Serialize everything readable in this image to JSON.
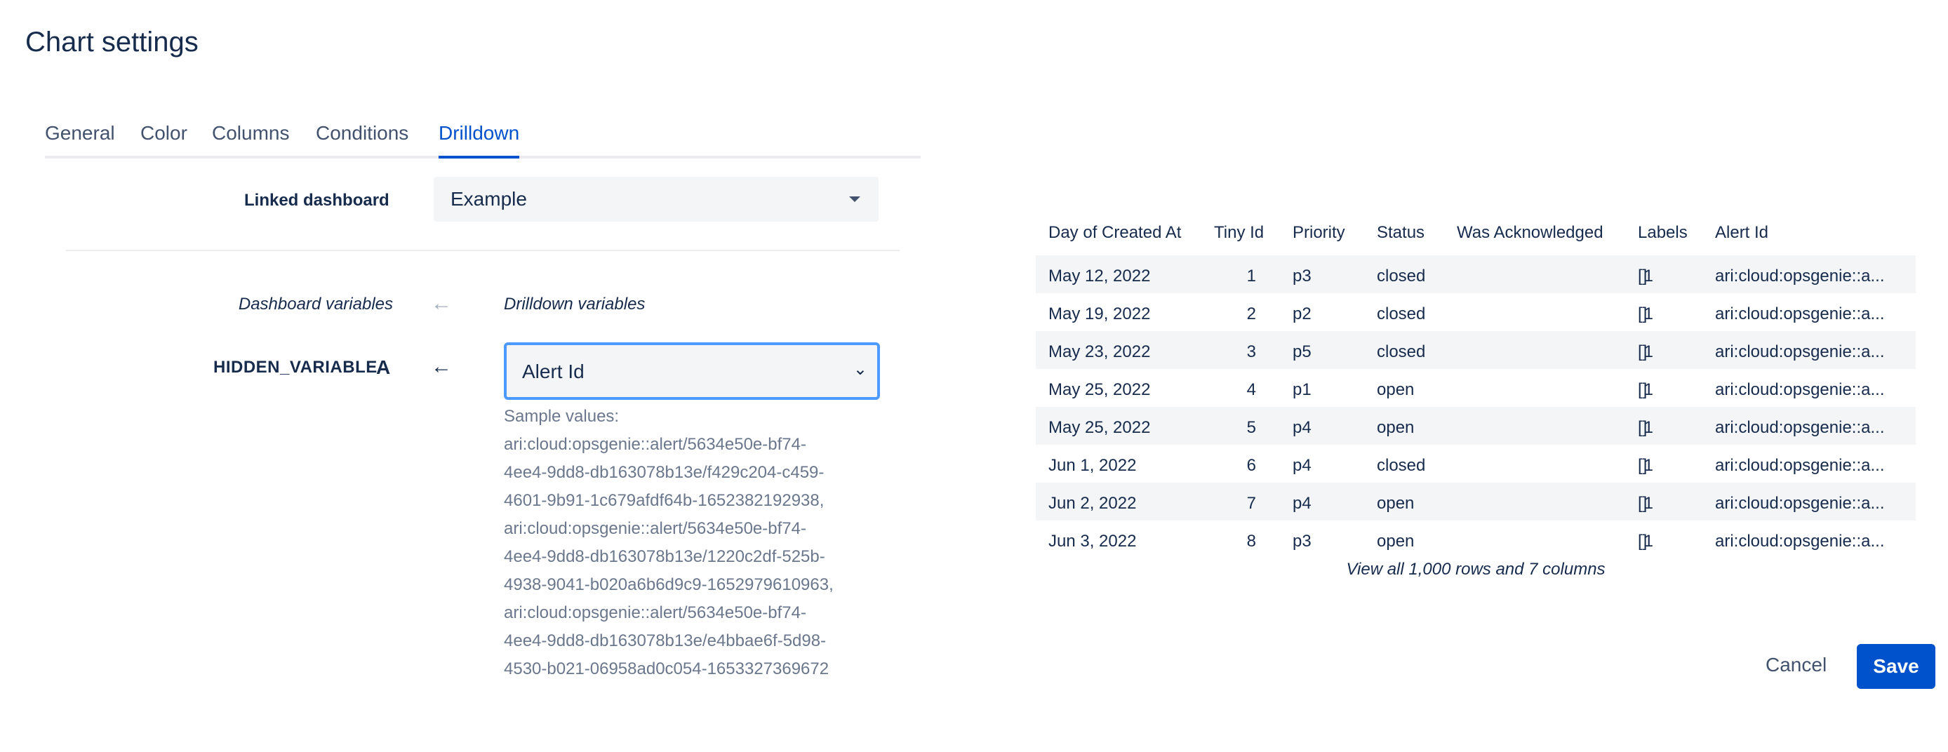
{
  "title": "Chart settings",
  "tabs": [
    {
      "label": "General"
    },
    {
      "label": "Color"
    },
    {
      "label": "Columns"
    },
    {
      "label": "Conditions"
    },
    {
      "label": "Drilldown",
      "active": true
    }
  ],
  "linked_dashboard": {
    "label": "Linked dashboard",
    "value": "Example"
  },
  "variables": {
    "dashboard_label": "Dashboard variables",
    "drilldown_label": "Drilldown variables",
    "name": "HIDDEN_VARIABLE",
    "name_icon": "A",
    "selected": "Alert Id",
    "sample_title": "Sample values:",
    "sample_lines": [
      "ari:cloud:opsgenie::alert/5634e50e-bf74-",
      "4ee4-9dd8-db163078b13e/f429c204-c459-",
      "4601-9b91-1c679afdf64b-1652382192938,",
      "ari:cloud:opsgenie::alert/5634e50e-bf74-",
      "4ee4-9dd8-db163078b13e/1220c2df-525b-",
      "4938-9041-b020a6b6d9c9-1652979610963,",
      "ari:cloud:opsgenie::alert/5634e50e-bf74-",
      "4ee4-9dd8-db163078b13e/e4bbae6f-5d98-",
      "4530-b021-06958ad0c054-1653327369672"
    ]
  },
  "table": {
    "headers": [
      "Day of Created At",
      "Tiny Id",
      "Priority",
      "Status",
      "Was Acknowledged",
      "Labels",
      "Alert Id"
    ],
    "rows": [
      [
        "May 12, 2022",
        "1",
        "p3",
        "closed",
        "1",
        "[]",
        "ari:cloud:opsgenie::a..."
      ],
      [
        "May 19, 2022",
        "2",
        "p2",
        "closed",
        "1",
        "[]",
        "ari:cloud:opsgenie::a..."
      ],
      [
        "May 23, 2022",
        "3",
        "p5",
        "closed",
        "1",
        "[]",
        "ari:cloud:opsgenie::a..."
      ],
      [
        "May 25, 2022",
        "4",
        "p1",
        "open",
        "1",
        "[]",
        "ari:cloud:opsgenie::a..."
      ],
      [
        "May 25, 2022",
        "5",
        "p4",
        "open",
        "1",
        "[]",
        "ari:cloud:opsgenie::a..."
      ],
      [
        "Jun 1, 2022",
        "6",
        "p4",
        "closed",
        "1",
        "[]",
        "ari:cloud:opsgenie::a..."
      ],
      [
        "Jun 2, 2022",
        "7",
        "p4",
        "open",
        "1",
        "[]",
        "ari:cloud:opsgenie::a..."
      ],
      [
        "Jun 3, 2022",
        "8",
        "p3",
        "open",
        "1",
        "[]",
        "ari:cloud:opsgenie::a..."
      ]
    ],
    "view_all": "View all 1,000 rows and 7 columns"
  },
  "buttons": {
    "cancel": "Cancel",
    "save": "Save"
  },
  "colors": {
    "accent": "#0052cc",
    "focus": "#4c9aff"
  }
}
